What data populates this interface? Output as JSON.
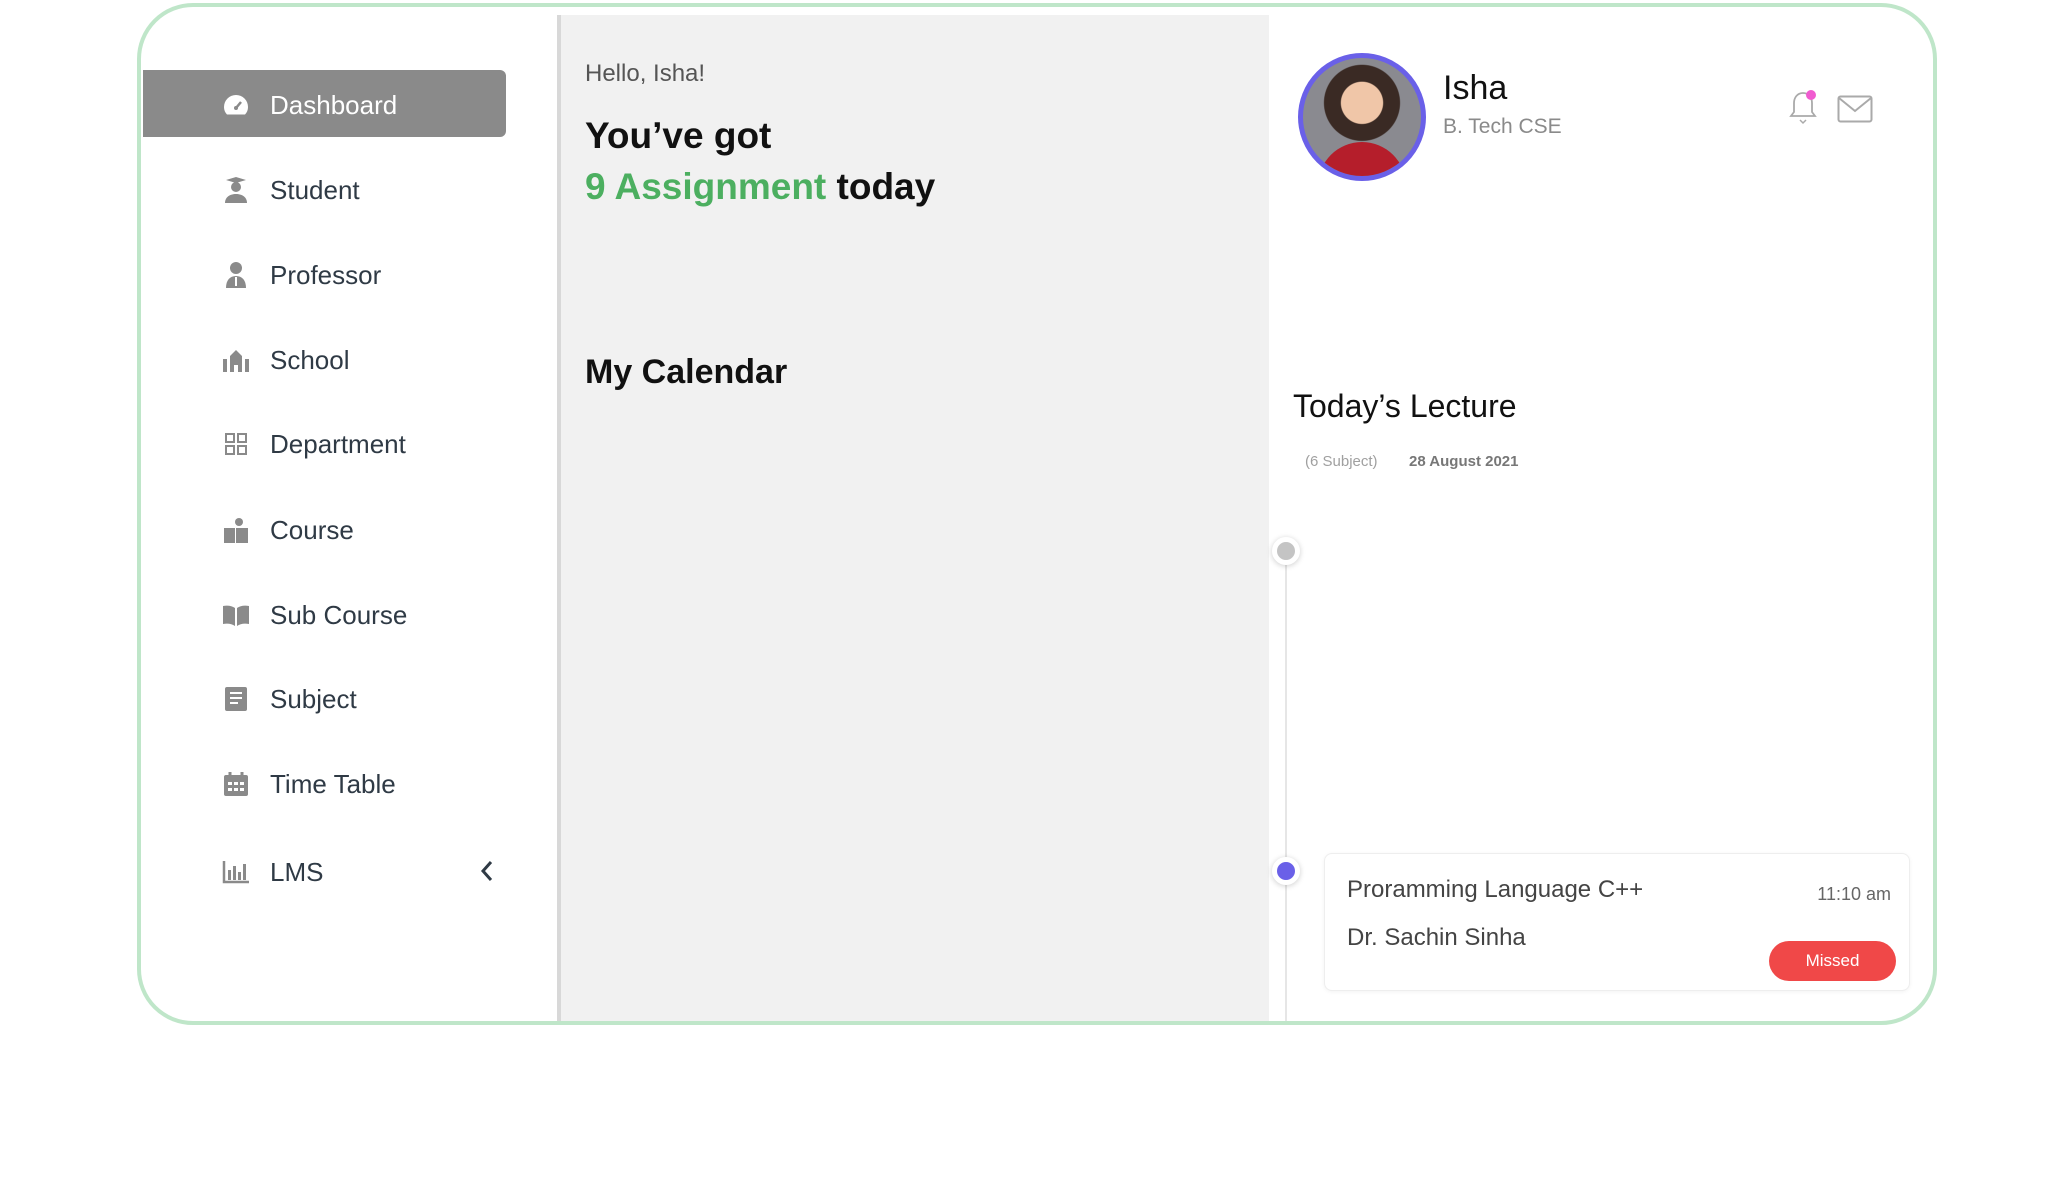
{
  "sidebar": {
    "items": [
      {
        "label": "Dashboard",
        "icon": "dashboard-gauge-icon",
        "active": true
      },
      {
        "label": "Student",
        "icon": "student-icon"
      },
      {
        "label": "Professor",
        "icon": "professor-icon"
      },
      {
        "label": "School",
        "icon": "school-icon"
      },
      {
        "label": "Department",
        "icon": "grid-icon"
      },
      {
        "label": "Course",
        "icon": "course-icon"
      },
      {
        "label": "Sub Course",
        "icon": "book-icon"
      },
      {
        "label": "Subject",
        "icon": "notebook-icon"
      },
      {
        "label": "Time Table",
        "icon": "calendar-icon"
      },
      {
        "label": "LMS",
        "icon": "bar-chart-icon",
        "expandable": true
      }
    ]
  },
  "main": {
    "greeting": "Hello, Isha!",
    "headline_1": "You’ve got",
    "assignment_count": "9 Assignment",
    "headline_2": "today",
    "calendar_title": "My Calendar"
  },
  "profile": {
    "name": "Isha",
    "program": "B. Tech CSE",
    "has_notification": true
  },
  "lectures": {
    "title": "Today’s Lecture",
    "subject_count": "(6 Subject)",
    "date": "28 August 2021",
    "items": [
      {
        "subject": "Proramming Language C++",
        "professor": "Dr. Sachin Sinha",
        "time": "11:10 am",
        "status": "Missed"
      }
    ]
  },
  "colors": {
    "accent_green": "#4caf60",
    "frame_border": "#bfe6c9",
    "active_nav": "#8a8a8a",
    "avatar_ring": "#6a60e8",
    "missed": "#f04848",
    "notification_dot": "#f05bd0"
  }
}
